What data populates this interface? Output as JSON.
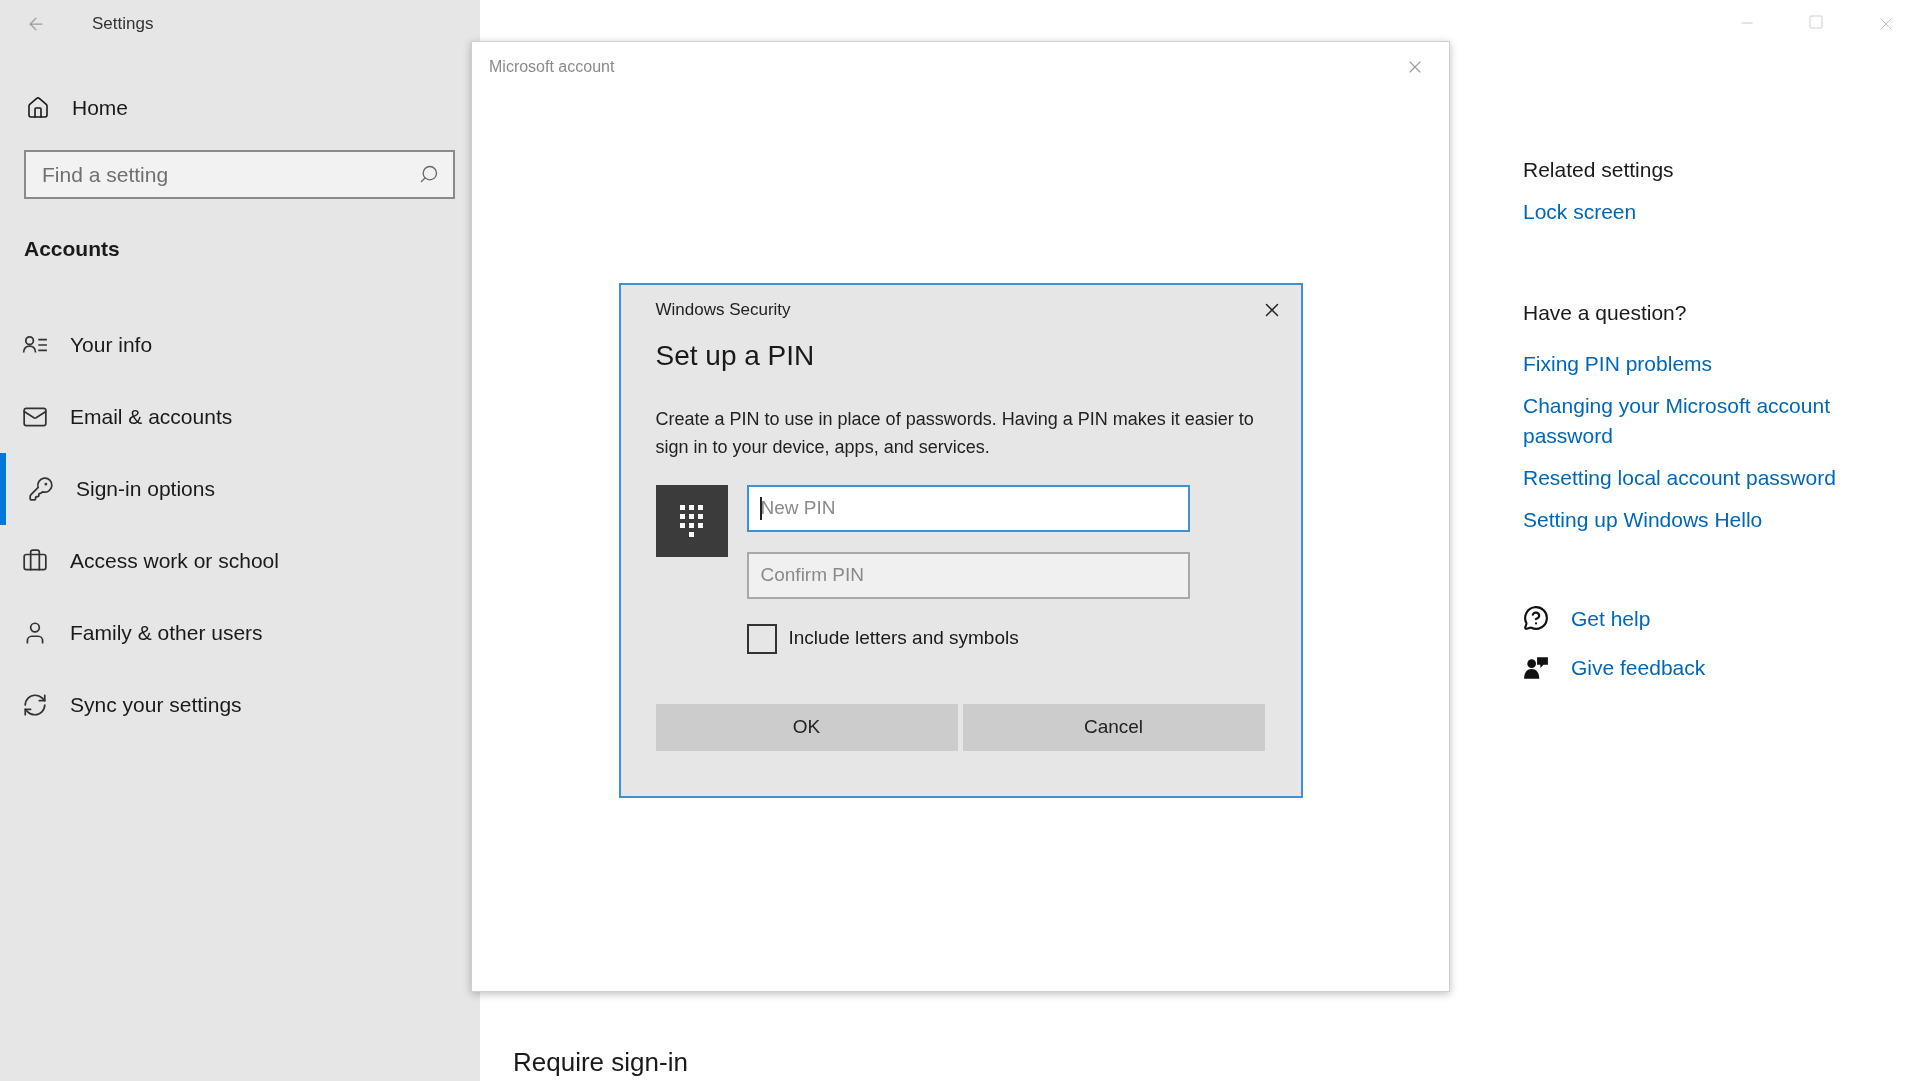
{
  "window": {
    "title": "Settings"
  },
  "sidebar": {
    "home": "Home",
    "search": {
      "placeholder": "Find a setting"
    },
    "section": "Accounts",
    "items": [
      {
        "label": "Your info",
        "selected": false
      },
      {
        "label": "Email & accounts",
        "selected": false
      },
      {
        "label": "Sign-in options",
        "selected": true
      },
      {
        "label": "Access work or school",
        "selected": false
      },
      {
        "label": "Family & other users",
        "selected": false
      },
      {
        "label": "Sync your settings",
        "selected": false
      }
    ]
  },
  "main": {
    "heading": "Require sign-in"
  },
  "related": {
    "title": "Related settings",
    "links": [
      "Lock screen"
    ]
  },
  "question": {
    "title": "Have a question?",
    "links": [
      "Fixing PIN problems",
      "Changing your Microsoft account password",
      "Resetting local account password",
      "Setting up Windows Hello"
    ]
  },
  "support": [
    "Get help",
    "Give feedback"
  ],
  "account_window": {
    "title": "Microsoft account"
  },
  "dialog": {
    "caption": "Windows Security",
    "title": "Set up a PIN",
    "text": "Create a PIN to use in place of passwords. Having a PIN makes it easier to sign in to your device, apps, and services.",
    "fields": [
      {
        "placeholder": "New PIN",
        "focused": true
      },
      {
        "placeholder": "Confirm PIN",
        "focused": false
      }
    ],
    "checkbox": {
      "label": "Include letters and symbols",
      "checked": false
    },
    "buttons": [
      "OK",
      "Cancel"
    ]
  }
}
